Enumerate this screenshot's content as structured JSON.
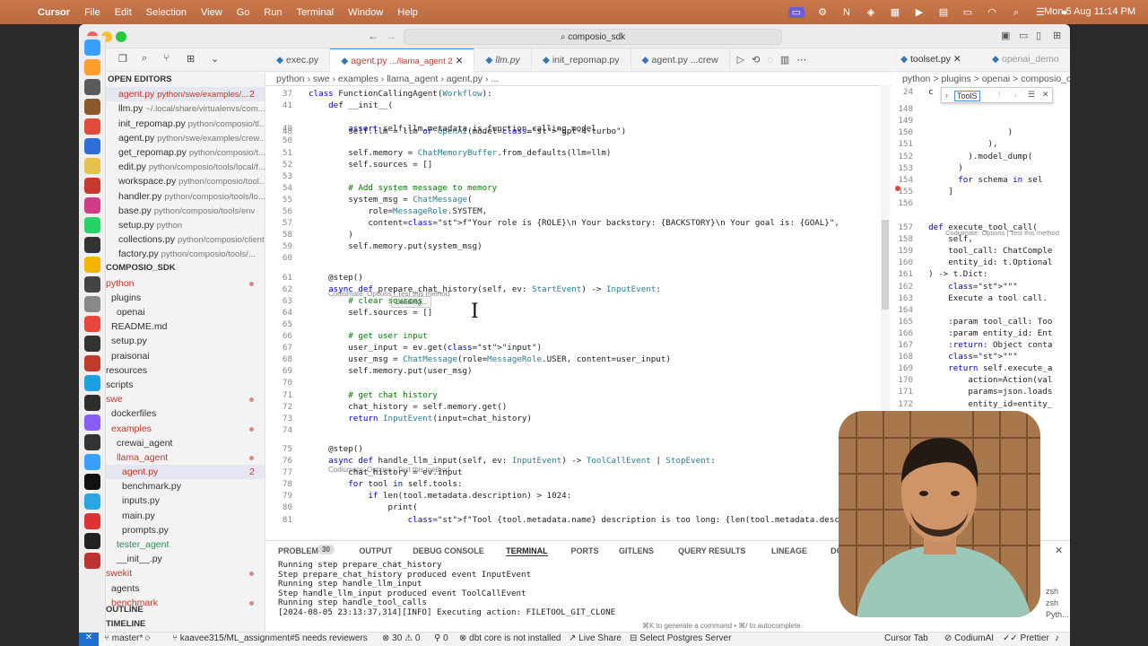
{
  "menubar": {
    "app": "Cursor",
    "items": [
      "File",
      "Edit",
      "Selection",
      "View",
      "Go",
      "Run",
      "Terminal",
      "Window",
      "Help"
    ],
    "clock": "Mon 5 Aug  11:14 PM"
  },
  "window": {
    "address": "composio_sdk"
  },
  "sidebar": {
    "open_editors_title": "OPEN EDITORS",
    "open_editors": [
      {
        "name": "agent.py",
        "path": "python/swe/examples/...",
        "badge": "2",
        "active": true
      },
      {
        "name": "llm.py",
        "path": "~/.local/share/virtualenvs/com..."
      },
      {
        "name": "init_repomap.py",
        "path": "python/composio/tl..."
      },
      {
        "name": "agent.py",
        "path": "python/swe/examples/crew..."
      },
      {
        "name": "get_repomap.py",
        "path": "python/composio/t..."
      },
      {
        "name": "edit.py",
        "path": "python/composio/tools/local/f..."
      },
      {
        "name": "workspace.py",
        "path": "python/composio/tool..."
      },
      {
        "name": "handler.py",
        "path": "python/composio/tools/lo..."
      },
      {
        "name": "base.py",
        "path": "python/composio/tools/env"
      },
      {
        "name": "setup.py",
        "path": "python"
      },
      {
        "name": "collections.py",
        "path": "python/composio/client"
      },
      {
        "name": "factory.py",
        "path": "python/composio/tools/..."
      }
    ],
    "project_title": "COMPOSIO_SDK",
    "tree": [
      {
        "label": "python",
        "indent": 0,
        "red": true,
        "dot": true
      },
      {
        "label": "plugins",
        "indent": 1
      },
      {
        "label": "openai",
        "indent": 2
      },
      {
        "label": "README.md",
        "indent": 1
      },
      {
        "label": "setup.py",
        "indent": 1
      },
      {
        "label": "praisonai",
        "indent": 1
      },
      {
        "label": "resources",
        "indent": 0
      },
      {
        "label": "scripts",
        "indent": 0
      },
      {
        "label": "swe",
        "indent": 0,
        "red": true,
        "dot": true
      },
      {
        "label": "dockerfiles",
        "indent": 1
      },
      {
        "label": "examples",
        "indent": 1,
        "red": true,
        "dot": true
      },
      {
        "label": "crewai_agent",
        "indent": 2
      },
      {
        "label": "llama_agent",
        "indent": 2,
        "red": true,
        "dot": true
      },
      {
        "label": "agent.py",
        "indent": 3,
        "red": true,
        "badge": "2",
        "active": true
      },
      {
        "label": "benchmark.py",
        "indent": 3
      },
      {
        "label": "inputs.py",
        "indent": 3
      },
      {
        "label": "main.py",
        "indent": 3
      },
      {
        "label": "prompts.py",
        "indent": 3
      },
      {
        "label": "tester_agent",
        "indent": 2,
        "green": true
      },
      {
        "label": "__init__.py",
        "indent": 2
      },
      {
        "label": "swekit",
        "indent": 0,
        "red": true,
        "dot": true
      },
      {
        "label": "agents",
        "indent": 1
      },
      {
        "label": "benchmark",
        "indent": 1,
        "red": true,
        "dot": true
      }
    ],
    "outline": "OUTLINE",
    "timeline": "TIMELINE"
  },
  "tabs": [
    {
      "label": "exec.py"
    },
    {
      "label": "agent.py",
      "sub": ".../llama_agent 2",
      "active": true
    },
    {
      "label": "llm.py"
    },
    {
      "label": "init_repomap.py"
    },
    {
      "label": "agent.py ...crew"
    }
  ],
  "breadcrumb": [
    "python",
    "swe",
    "examples",
    "llama_agent",
    "agent.py",
    "..."
  ],
  "code_lines": [
    {
      "n": "37",
      "t": "class FunctionCallingAgent(Workflow):"
    },
    {
      "n": "41",
      "t": "    def __init__("
    },
    {
      "n": "48",
      "t": "        self.llm = llm or OpenAI(model=\"gpt-4-turbo\")"
    },
    {
      "n": "49",
      "t": "        assert self.llm.metadata.is_function_calling_model"
    },
    {
      "n": "50",
      "t": ""
    },
    {
      "n": "51",
      "t": "        self.memory = ChatMemoryBuffer.from_defaults(llm=llm)"
    },
    {
      "n": "52",
      "t": "        self.sources = []"
    },
    {
      "n": "53",
      "t": ""
    },
    {
      "n": "54",
      "t": "        # Add system message to memory"
    },
    {
      "n": "55",
      "t": "        system_msg = ChatMessage("
    },
    {
      "n": "56",
      "t": "            role=MessageRole.SYSTEM,"
    },
    {
      "n": "57",
      "t": "            content=f\"Your role is {ROLE}\\n Your backstory: {BACKSTORY}\\n Your goal is: {GOAL}\","
    },
    {
      "n": "58",
      "t": "        )"
    },
    {
      "n": "59",
      "t": "        self.memory.put(system_msg)"
    },
    {
      "n": "60",
      "t": ""
    },
    {
      "n": "61",
      "t": "    @step()"
    },
    {
      "n": "62",
      "t": "    async def prepare_chat_history(self, ev: StartEvent) -> InputEvent:"
    },
    {
      "n": "63",
      "t": "        # clear sources"
    },
    {
      "n": "64",
      "t": "        self.sources = []"
    },
    {
      "n": "65",
      "t": ""
    },
    {
      "n": "66",
      "t": "        # get user input"
    },
    {
      "n": "67",
      "t": "        user_input = ev.get(\"input\")"
    },
    {
      "n": "68",
      "t": "        user_msg = ChatMessage(role=MessageRole.USER, content=user_input)"
    },
    {
      "n": "69",
      "t": "        self.memory.put(user_msg)"
    },
    {
      "n": "70",
      "t": ""
    },
    {
      "n": "71",
      "t": "        # get chat history"
    },
    {
      "n": "72",
      "t": "        chat_history = self.memory.get()"
    },
    {
      "n": "73",
      "t": "        return InputEvent(input=chat_history)"
    },
    {
      "n": "74",
      "t": ""
    },
    {
      "n": "75",
      "t": "    @step()"
    },
    {
      "n": "76",
      "t": "    async def handle_llm_input(self, ev: InputEvent) -> ToolCallEvent | StopEvent:"
    },
    {
      "n": "77",
      "t": "        chat_history = ev.input"
    },
    {
      "n": "78",
      "t": "        for tool in self.tools:"
    },
    {
      "n": "79",
      "t": "            if len(tool.metadata.description) > 1024:"
    },
    {
      "n": "80",
      "t": "                print("
    },
    {
      "n": "81",
      "t": "                    f\"Tool {tool.metadata.name} description is too long: {len(tool.metadata.description)}\""
    }
  ],
  "codelens": {
    "first": "Codiumate: Options | Test this method",
    "loading": "Loading...",
    "second": "Codiumate: Options | Test this method"
  },
  "right_pane": {
    "tabs": [
      "toolset.py",
      "openai_demo"
    ],
    "breadcrumb": "python > plugins > openai > composio_op",
    "find_label": "ToolS",
    "lines": [
      {
        "n": "24",
        "t": "  c"
      },
      {
        "n": "148",
        "t": ""
      },
      {
        "n": "149",
        "t": ""
      },
      {
        "n": "150",
        "t": "                  )"
      },
      {
        "n": "151",
        "t": "              ),"
      },
      {
        "n": "152",
        "t": "          ).model_dump("
      },
      {
        "n": "153",
        "t": "        )"
      },
      {
        "n": "154",
        "t": "        for schema in sel"
      },
      {
        "n": "155",
        "t": "      ]"
      },
      {
        "n": "156",
        "t": ""
      },
      {
        "n": "157",
        "t": "  def execute_tool_call("
      },
      {
        "n": "158",
        "t": "      self,"
      },
      {
        "n": "159",
        "t": "      tool_call: ChatComple"
      },
      {
        "n": "160",
        "t": "      entity_id: t.Optional"
      },
      {
        "n": "161",
        "t": "  ) -> t.Dict:"
      },
      {
        "n": "162",
        "t": "      \"\"\""
      },
      {
        "n": "163",
        "t": "      Execute a tool call."
      },
      {
        "n": "164",
        "t": ""
      },
      {
        "n": "165",
        "t": "      :param tool_call: Too"
      },
      {
        "n": "166",
        "t": "      :param entity_id: Ent"
      },
      {
        "n": "167",
        "t": "      :return: Object conta"
      },
      {
        "n": "168",
        "t": "      \"\"\""
      },
      {
        "n": "169",
        "t": "      return self.execute_a"
      },
      {
        "n": "170",
        "t": "          action=Action(val"
      },
      {
        "n": "171",
        "t": "          params=json.loads"
      },
      {
        "n": "172",
        "t": "          entity_id=entity_"
      },
      {
        "n": "173",
        "t": "      )"
      }
    ],
    "lens": "Codiumate: Options | Test this method"
  },
  "panel": {
    "tabs": [
      "PROBLEMS",
      "OUTPUT",
      "DEBUG CONSOLE",
      "TERMINAL",
      "PORTS",
      "GITLENS",
      "QUERY RESULTS",
      "LINEAGE",
      "DOCUMENTATION EDIT"
    ],
    "problems_count": "30",
    "active_tab": "TERMINAL",
    "terminal_lines": [
      "Running step prepare_chat_history",
      "Step prepare_chat_history produced event InputEvent",
      "Running step handle_llm_input",
      "Step handle_llm_input produced event ToolCallEvent",
      "Running step handle_tool_calls",
      "[2024-08-05 23:13:37,314][INFO] Executing action: FILETOOL_GIT_CLONE"
    ],
    "hint": "⌘K to generate a command • ⌘/ to autocomplete",
    "side_items": [
      "zsh",
      "zsh",
      "Pyth..."
    ]
  },
  "status": {
    "branch": "master*",
    "pr": "kaavee315/ML_assignment#5 needs reviewers",
    "problems": "30",
    "warnings": "0",
    "ports": "0",
    "dbt": "dbt core is not installed",
    "live_share": "Live Share",
    "postgres": "Select Postgres Server",
    "cursor_tab": "Cursor Tab",
    "codium": "CodiumAI",
    "prettier": "Prettier"
  },
  "colors": {
    "menubar": "#c0734a",
    "accent": "#4a90e2",
    "error": "#c0392b"
  }
}
